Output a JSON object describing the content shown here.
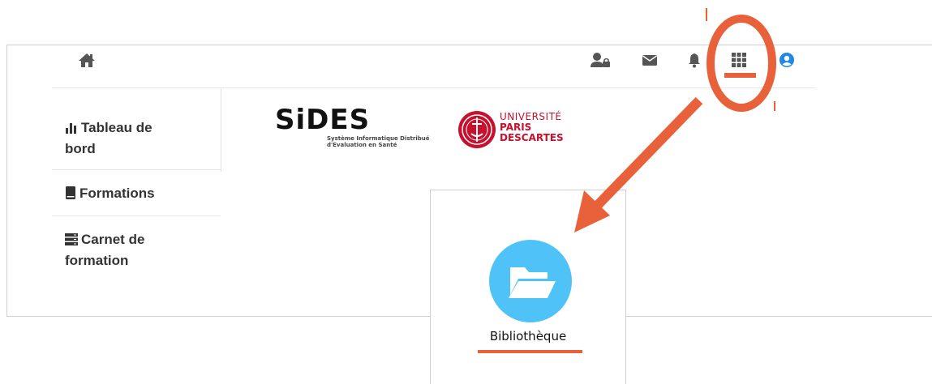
{
  "header": {
    "icons": [
      "home-icon",
      "user-lock-icon",
      "envelope-icon",
      "bell-icon",
      "grid-apps-icon",
      "user-circle-icon"
    ]
  },
  "sidebar": {
    "items": [
      {
        "label": "Tableau de bord",
        "line1": "Tableau de",
        "line2": "bord",
        "icon": "chart-bar-icon"
      },
      {
        "label": "Formations",
        "icon": "book-icon"
      },
      {
        "label": "Carnet de formation",
        "line1": "Carnet de",
        "line2": "formation",
        "icon": "server-list-icon"
      }
    ]
  },
  "logos": {
    "sides_name": "SiDES",
    "sides_line1": "Système Informatique Distribué",
    "sides_line2": "d'Evaluation en Santé",
    "univ_line1": "UNIVERSITÉ",
    "univ_line2": "PARIS",
    "univ_line3": "DESCARTES"
  },
  "apps_menu": {
    "items": [
      {
        "label": "Bibliothèque",
        "icon": "folder-open-icon"
      }
    ]
  },
  "colors": {
    "annotation": "#e8613a",
    "bibliotheque_circle": "#4fc3f7",
    "univ_red": "#c8102e",
    "avatar_blue": "#1e88e5"
  }
}
